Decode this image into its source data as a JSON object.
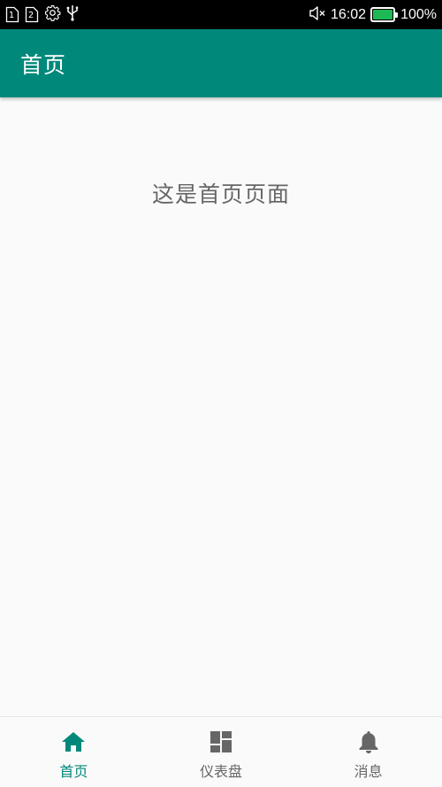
{
  "status_bar": {
    "sim1_label": "1",
    "sim2_label": "2",
    "time": "16:02",
    "battery_percent": "100%",
    "battery_level": 1.0,
    "battery_color": "#1db954",
    "icons": [
      "sim-1-icon",
      "sim-2-icon",
      "settings-icon",
      "usb-icon",
      "mute-icon",
      "battery-icon"
    ]
  },
  "app_bar": {
    "title": "首页",
    "color": "#00897b"
  },
  "main": {
    "page_text": "这是首页页面"
  },
  "bottom_nav": {
    "active_color": "#00897b",
    "inactive_color": "#666666",
    "items": [
      {
        "label": "首页",
        "icon": "home-icon",
        "active": true
      },
      {
        "label": "仪表盘",
        "icon": "dashboard-icon",
        "active": false
      },
      {
        "label": "消息",
        "icon": "bell-icon",
        "active": false
      }
    ]
  }
}
